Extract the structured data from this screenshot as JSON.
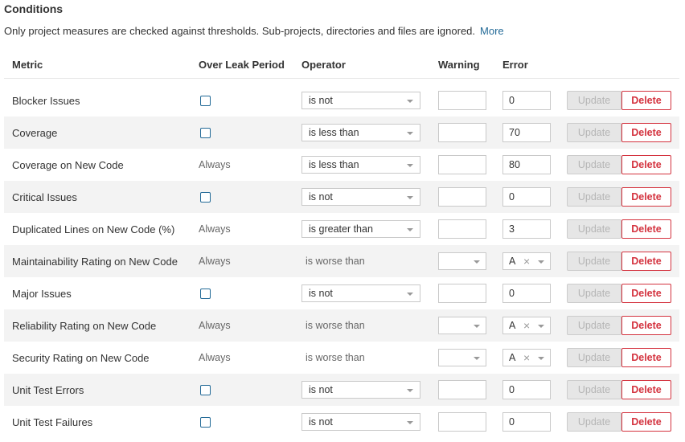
{
  "section": {
    "title": "Conditions",
    "description": "Only project measures are checked against thresholds. Sub-projects, directories and files are ignored.",
    "more_link": "More"
  },
  "columns": {
    "metric": "Metric",
    "leak": "Over Leak Period",
    "operator": "Operator",
    "warning": "Warning",
    "error": "Error"
  },
  "buttons": {
    "update": "Update",
    "delete": "Delete"
  },
  "rows": [
    {
      "metric": "Blocker Issues",
      "leak": "checkbox",
      "operator": "is not",
      "operator_kind": "select",
      "warning": "",
      "error": "0",
      "error_kind": "input"
    },
    {
      "metric": "Coverage",
      "leak": "checkbox",
      "operator": "is less than",
      "operator_kind": "select",
      "warning": "",
      "error": "70",
      "error_kind": "input"
    },
    {
      "metric": "Coverage on New Code",
      "leak": "Always",
      "operator": "is less than",
      "operator_kind": "select",
      "warning": "",
      "error": "80",
      "error_kind": "input"
    },
    {
      "metric": "Critical Issues",
      "leak": "checkbox",
      "operator": "is not",
      "operator_kind": "select",
      "warning": "",
      "error": "0",
      "error_kind": "input"
    },
    {
      "metric": "Duplicated Lines on New Code (%)",
      "leak": "Always",
      "operator": "is greater than",
      "operator_kind": "select",
      "warning": "",
      "error": "3",
      "error_kind": "input"
    },
    {
      "metric": "Maintainability Rating on New Code",
      "leak": "Always",
      "operator": "is worse than",
      "operator_kind": "text",
      "warning": "",
      "error": "A",
      "error_kind": "rating"
    },
    {
      "metric": "Major Issues",
      "leak": "checkbox",
      "operator": "is not",
      "operator_kind": "select",
      "warning": "",
      "error": "0",
      "error_kind": "input"
    },
    {
      "metric": "Reliability Rating on New Code",
      "leak": "Always",
      "operator": "is worse than",
      "operator_kind": "text",
      "warning": "",
      "error": "A",
      "error_kind": "rating"
    },
    {
      "metric": "Security Rating on New Code",
      "leak": "Always",
      "operator": "is worse than",
      "operator_kind": "text",
      "warning": "",
      "error": "A",
      "error_kind": "rating"
    },
    {
      "metric": "Unit Test Errors",
      "leak": "checkbox",
      "operator": "is not",
      "operator_kind": "select",
      "warning": "",
      "error": "0",
      "error_kind": "input"
    },
    {
      "metric": "Unit Test Failures",
      "leak": "checkbox",
      "operator": "is not",
      "operator_kind": "select",
      "warning": "",
      "error": "0",
      "error_kind": "input"
    }
  ],
  "icons": {
    "clear": "×"
  }
}
